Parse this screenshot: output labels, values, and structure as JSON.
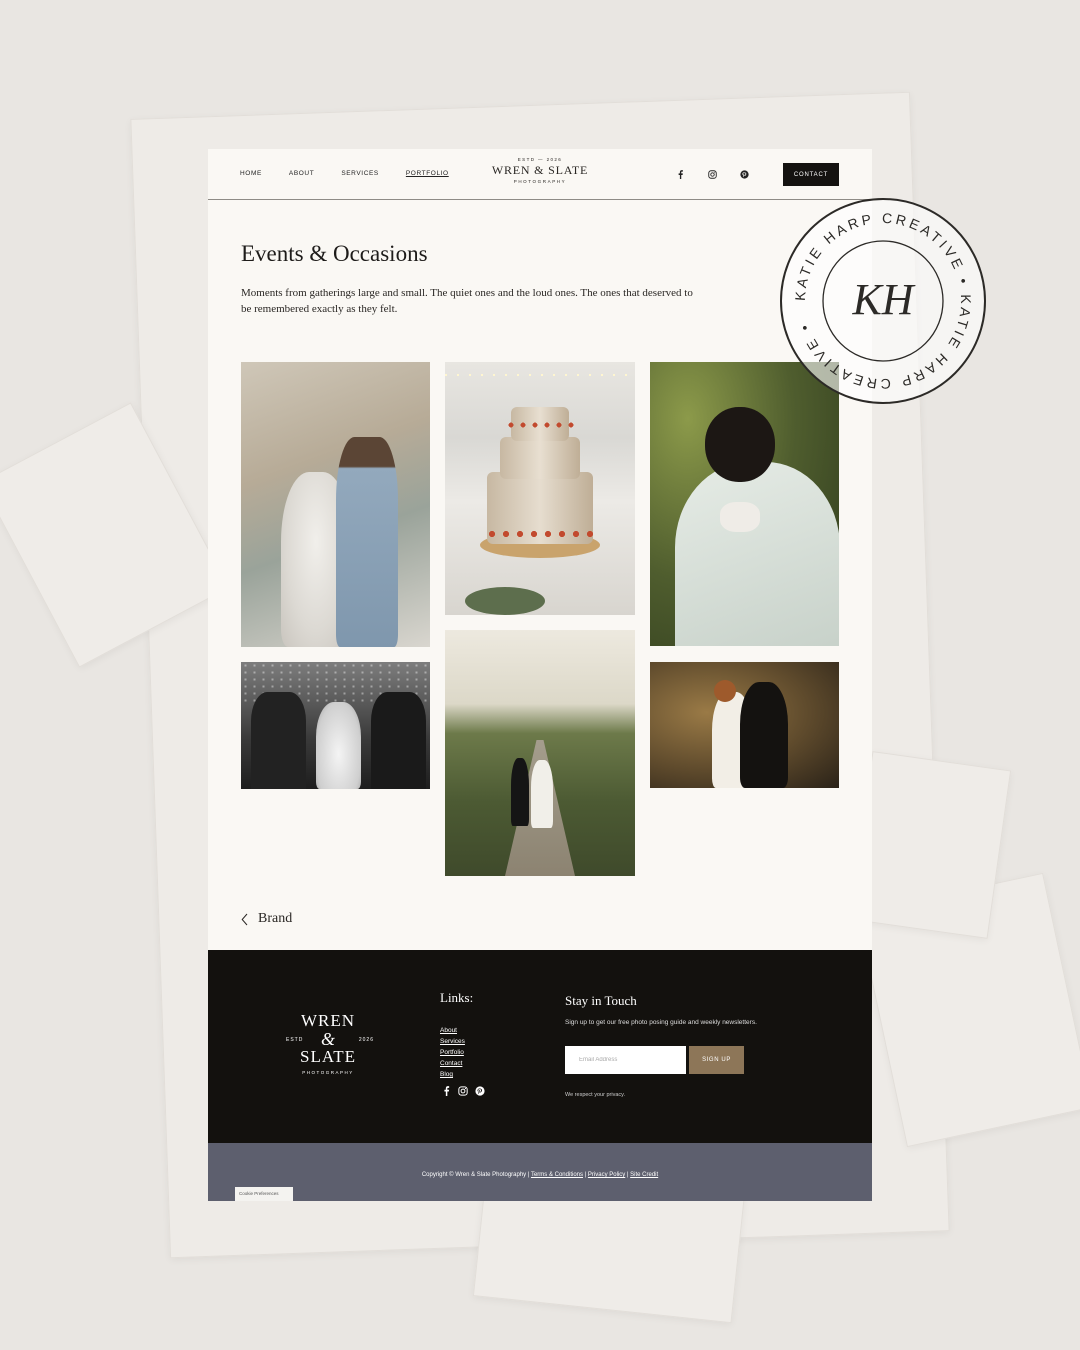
{
  "nav": {
    "links": [
      "HOME",
      "ABOUT",
      "SERVICES",
      "PORTFOLIO"
    ],
    "active": "PORTFOLIO",
    "contact_label": "CONTACT",
    "social_icons": [
      "facebook-icon",
      "instagram-icon",
      "pinterest-icon"
    ]
  },
  "logo": {
    "estd": "ESTD — 2026",
    "name": "WREN & SLATE",
    "sub": "PHOTOGRAPHY"
  },
  "main": {
    "title": "Events & Occasions",
    "lead": "Moments from gatherings large and small. The quiet ones and the loud ones. The ones that deserved to be remembered exactly as they felt.",
    "back_link": "Brand",
    "back_icon": "chevron-left-icon"
  },
  "footer": {
    "logo": {
      "line1": "WREN",
      "amp": "&",
      "line2": "SLATE",
      "estd": "ESTD",
      "year": "2026",
      "sub": "PHOTOGRAPHY"
    },
    "links_title": "Links:",
    "links": [
      "About",
      "Services",
      "Portfolio",
      "Contact",
      "Blog"
    ],
    "stay_title": "Stay in Touch",
    "stay_text": "Sign up to get our free photo posing guide and weekly newsletters.",
    "email_placeholder": "Email Address",
    "signup_label": "SIGN UP",
    "privacy": "We respect your privacy."
  },
  "bottom": {
    "copyright": "Copyright © Wren & Slate Photography |",
    "terms": "Terms & Conditions",
    "privacy": "Privacy Policy",
    "credit": "Site Credit",
    "cookie": "Cookie Preferences"
  },
  "stamp": {
    "ring_text": "KATIE HARP CREATIVE • KATIE HARP CREATIVE •",
    "monogram": "KH"
  },
  "colors": {
    "page_bg": "#faf8f4",
    "footer_bg": "#13110e",
    "bottom_bar": "#5d5f6e",
    "signup_button": "#8d7658",
    "contact_button": "#141210"
  }
}
